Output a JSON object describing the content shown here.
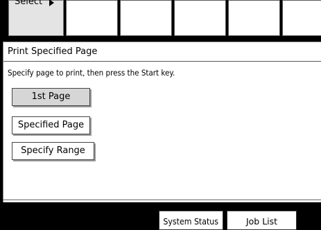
{
  "tabs": {
    "select_label": "Select",
    "others": [
      "",
      "",
      "",
      "",
      ""
    ]
  },
  "panel": {
    "title": "Print Specified Page",
    "instruction": "Specify page to print, then press the Start key.",
    "options": [
      {
        "label": "1st Page",
        "selected": true
      },
      {
        "label": "Specified Page",
        "selected": false
      },
      {
        "label": "Specify Range",
        "selected": false
      }
    ]
  },
  "bottom_bar": {
    "system_status_label": "System Status",
    "job_list_label": "Job List"
  },
  "colors": {
    "background": "#000000",
    "panel": "#ffffff",
    "selected_button": "#d6d6d6",
    "select_tab": "#e4e4e4"
  }
}
